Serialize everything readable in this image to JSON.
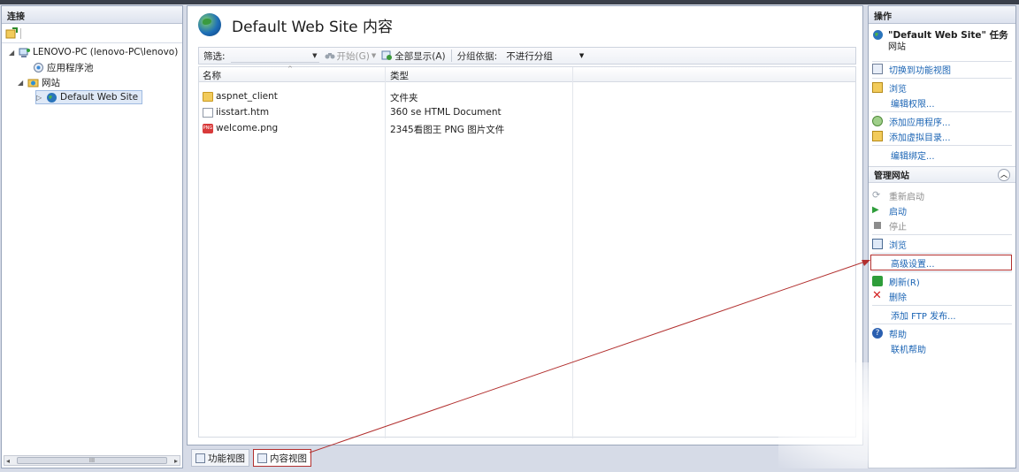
{
  "connections": {
    "title": "连接",
    "tree": [
      {
        "label": "LENOVO-PC (lenovo-PC\\lenovo)",
        "icon": "computer-icon"
      },
      {
        "label": "应用程序池",
        "icon": "app-pool-icon"
      },
      {
        "label": "网站",
        "icon": "sites-folder-icon"
      },
      {
        "label": "Default Web Site",
        "icon": "globe-icon"
      }
    ],
    "scroll_thumb": "III"
  },
  "content": {
    "title": "Default Web Site 内容",
    "filter": {
      "label": "筛选:",
      "start_label": "开始(G)",
      "show_all_label": "全部显示(A)",
      "group_by_label": "分组依据:",
      "group_by_value": "不进行分组"
    },
    "columns": [
      "名称",
      "类型"
    ],
    "rows": [
      {
        "name": "aspnet_client",
        "type": "文件夹",
        "icon": "folder-icon"
      },
      {
        "name": "iisstart.htm",
        "type": "360 se HTML Document",
        "icon": "document-icon"
      },
      {
        "name": "welcome.png",
        "type": "2345看图王 PNG 图片文件",
        "icon": "png-icon"
      }
    ]
  },
  "view_tabs": {
    "features_view": "功能视图",
    "content_view": "内容视图"
  },
  "actions": {
    "title": "操作",
    "task_title": "\"Default Web Site\" 任务",
    "task_subtitle": "网站",
    "switch_features": "切换到功能视图",
    "explore": "浏览",
    "edit_permissions": "编辑权限...",
    "add_application": "添加应用程序...",
    "add_virtual_dir": "添加虚拟目录...",
    "edit_bindings": "编辑绑定...",
    "manage_site": "管理网站",
    "restart": "重新启动",
    "start": "启动",
    "stop": "停止",
    "browse": "浏览",
    "advanced_settings": "高级设置...",
    "refresh": "刷新(R)",
    "delete": "删除",
    "add_ftp": "添加 FTP 发布...",
    "help": "帮助",
    "online_help": "联机帮助"
  },
  "colors": {
    "highlight": "#b2302f",
    "link": "#1b64b4"
  }
}
